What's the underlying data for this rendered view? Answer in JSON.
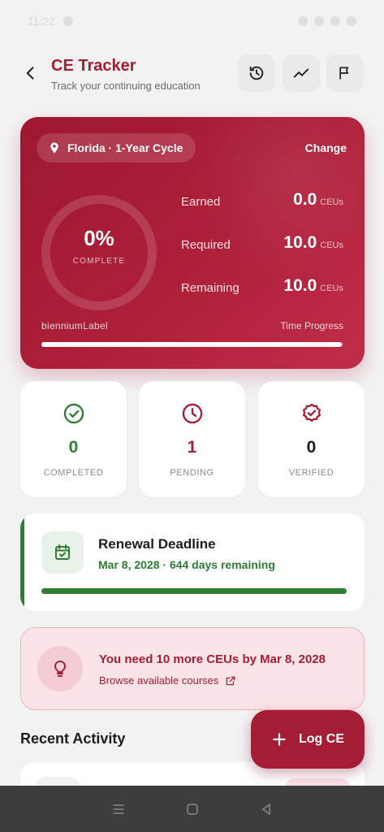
{
  "status_bar": {
    "time": "11:22"
  },
  "header": {
    "title": "CE Tracker",
    "subtitle": "Track your continuing education"
  },
  "hero": {
    "location": "Florida · 1-Year Cycle",
    "change_label": "Change",
    "percent": "0%",
    "percent_caption": "COMPLETE",
    "earned_label": "Earned",
    "earned_value": "0.0",
    "required_label": "Required",
    "required_value": "10.0",
    "remaining_label": "Remaining",
    "remaining_value": "10.0",
    "unit": "CEUs",
    "biennium_label": "bienniumLabel",
    "time_progress_label": "Time Progress",
    "time_progress_fraction": 0.995
  },
  "stats": [
    {
      "value": "0",
      "caption": "COMPLETED",
      "color": "#2e7d32",
      "icon": "check-circle-icon"
    },
    {
      "value": "1",
      "caption": "PENDING",
      "color": "#a51d35",
      "icon": "clock-icon"
    },
    {
      "value": "0",
      "caption": "VERIFIED",
      "color": "#1c1c1e",
      "icon": "verified-badge-icon"
    }
  ],
  "renewal": {
    "title": "Renewal Deadline",
    "subtitle": "Mar 8, 2028 · 644 days remaining",
    "progress_fraction": 1.0
  },
  "alert": {
    "text": "You need 10 more CEUs by Mar 8, 2028",
    "link": "Browse available courses"
  },
  "recent": {
    "title": "Recent Activity"
  },
  "fab": {
    "label": "Log CE"
  },
  "colors": {
    "brand": "#a51d35",
    "success": "#2e7d32"
  }
}
